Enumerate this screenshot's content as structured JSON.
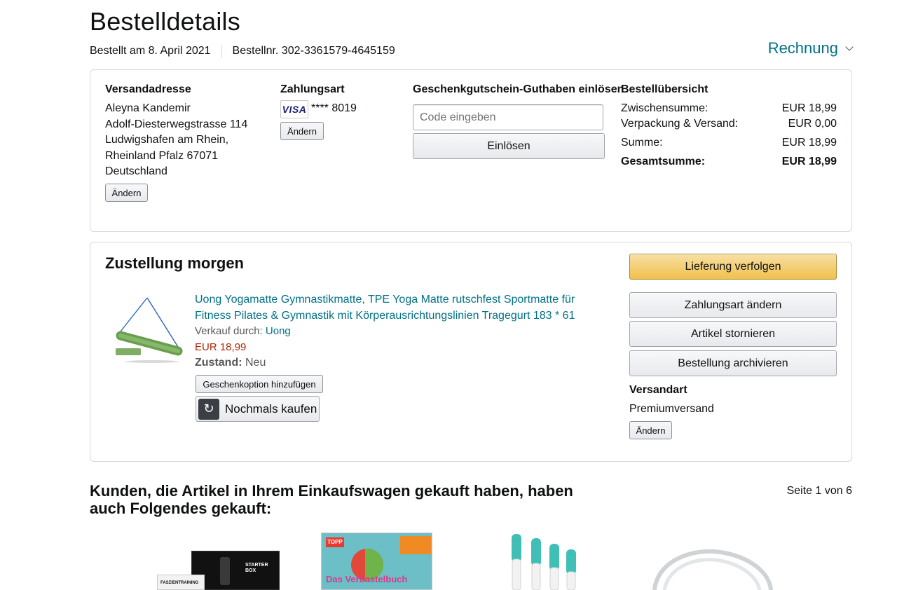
{
  "header": {
    "title": "Bestelldetails",
    "order_date": "Bestellt am 8. April 2021",
    "order_number": "Bestellnr. 302-3361579-4645159",
    "invoice_label": "Rechnung"
  },
  "summary_box": {
    "shipping": {
      "heading": "Versandadresse",
      "name": "Aleyna Kandemir",
      "street": "Adolf-Diesterwegstrasse 114",
      "city": "Ludwigshafen am Rhein,",
      "region": "Rheinland Pfalz 67071",
      "country": "Deutschland",
      "change_label": "Ändern"
    },
    "payment": {
      "heading": "Zahlungsart",
      "card_brand": "VISA",
      "card_masked": "**** 8019",
      "change_label": "Ändern"
    },
    "gift": {
      "heading": "Geschenkgutschein-Guthaben einlösen",
      "placeholder": "Code eingeben",
      "redeem_label": "Einlösen"
    },
    "overview": {
      "heading": "Bestellübersicht",
      "rows": [
        {
          "label": "Zwischensumme:",
          "value": "EUR 18,99"
        },
        {
          "label": "Verpackung & Versand:",
          "value": "EUR 0,00"
        },
        {
          "label": "Summe:",
          "value": "EUR 18,99"
        },
        {
          "label": "Gesamtsumme:",
          "value": "EUR 18,99"
        }
      ]
    }
  },
  "delivery": {
    "heading": "Zustellung morgen",
    "product": {
      "title_line1": "Uong Yogamatte Gymnastikmatte, TPE Yoga Matte rutschfest Sportmatte für",
      "title_line2": "Fitness Pilates & Gymnastik mit Körperausrichtungslinien Tragegurt 183 * 61",
      "sold_by_label": "Verkauf durch:",
      "seller": "Uong",
      "price": "EUR 18,99",
      "condition_label": "Zustand:",
      "condition": "Neu",
      "gift_option_label": "Geschenkoption hinzufügen",
      "buy_again_label": "Nochmals kaufen"
    },
    "actions": {
      "track": "Lieferung verfolgen",
      "change_payment": "Zahlungsart ändern",
      "cancel": "Artikel stornieren",
      "archive": "Bestellung archivieren"
    },
    "shipping_method": {
      "heading": "Versandart",
      "value": "Premiumversand",
      "change_label": "Ändern"
    }
  },
  "recommendations": {
    "title": "Kunden, die Artikel in Ihrem Einkaufswagen gekauft haben, haben auch Folgendes gekauft:",
    "page_info": "Seite 1 von 6",
    "items": [
      {
        "icon": "fascia-training-box-image",
        "text": "FASZIENTRAINING"
      },
      {
        "icon": "book-cover-image",
        "text": "Das Verbastelbuch"
      },
      {
        "icon": "toothbrush-heads-image",
        "text": ""
      },
      {
        "icon": "white-cable-image",
        "text": ""
      }
    ]
  },
  "colors": {
    "link": "#007185",
    "price": "#b12704",
    "primary_button": "#f0c14b",
    "border": "#d5d9d9"
  }
}
